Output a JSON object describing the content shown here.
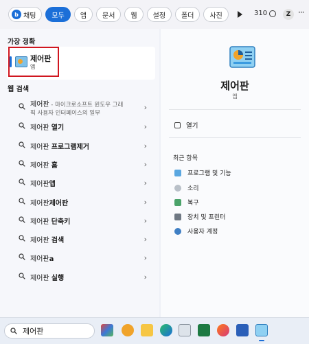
{
  "filters": {
    "chat": "채팅",
    "all": "모두",
    "apps": "앱",
    "documents": "문서",
    "web": "웹",
    "settings": "설정",
    "folders": "폴더",
    "photos": "사진",
    "points": "310",
    "user_initial": "Z",
    "more": "···"
  },
  "left": {
    "best_match_title": "가장 정확",
    "best_match": {
      "name": "제어판",
      "type": "앱"
    },
    "web_search_title": "웹 검색",
    "results": [
      {
        "prefix": "제어판",
        "bold": "",
        "desc": " - 마이크로소프트 윈도우 그래",
        "desc2": "픽 사용자 인터페이스의 일부"
      },
      {
        "prefix": "제어판 ",
        "bold": "열기"
      },
      {
        "prefix": "제어판 ",
        "bold": "프로그램제거"
      },
      {
        "prefix": "제어판 ",
        "bold": "홈"
      },
      {
        "prefix": "제어판",
        "bold": "앱"
      },
      {
        "prefix": "제어판",
        "bold": "제어판"
      },
      {
        "prefix": "제어판 ",
        "bold": "단축키"
      },
      {
        "prefix": "제어판 ",
        "bold": "검색"
      },
      {
        "prefix": "제어판",
        "bold": "a"
      },
      {
        "prefix": "제어판 ",
        "bold": "실행"
      }
    ]
  },
  "right": {
    "title": "제어판",
    "subtitle": "앱",
    "open_label": "열기",
    "recent_title": "최근 항목",
    "recent_items": [
      "프로그램 및 기능",
      "소리",
      "복구",
      "장치 및 프린터",
      "사용자 계정"
    ]
  },
  "taskbar": {
    "search_text": "제어판"
  },
  "colors": {
    "accent": "#1b6fd8",
    "highlight_border": "#d0161f"
  }
}
